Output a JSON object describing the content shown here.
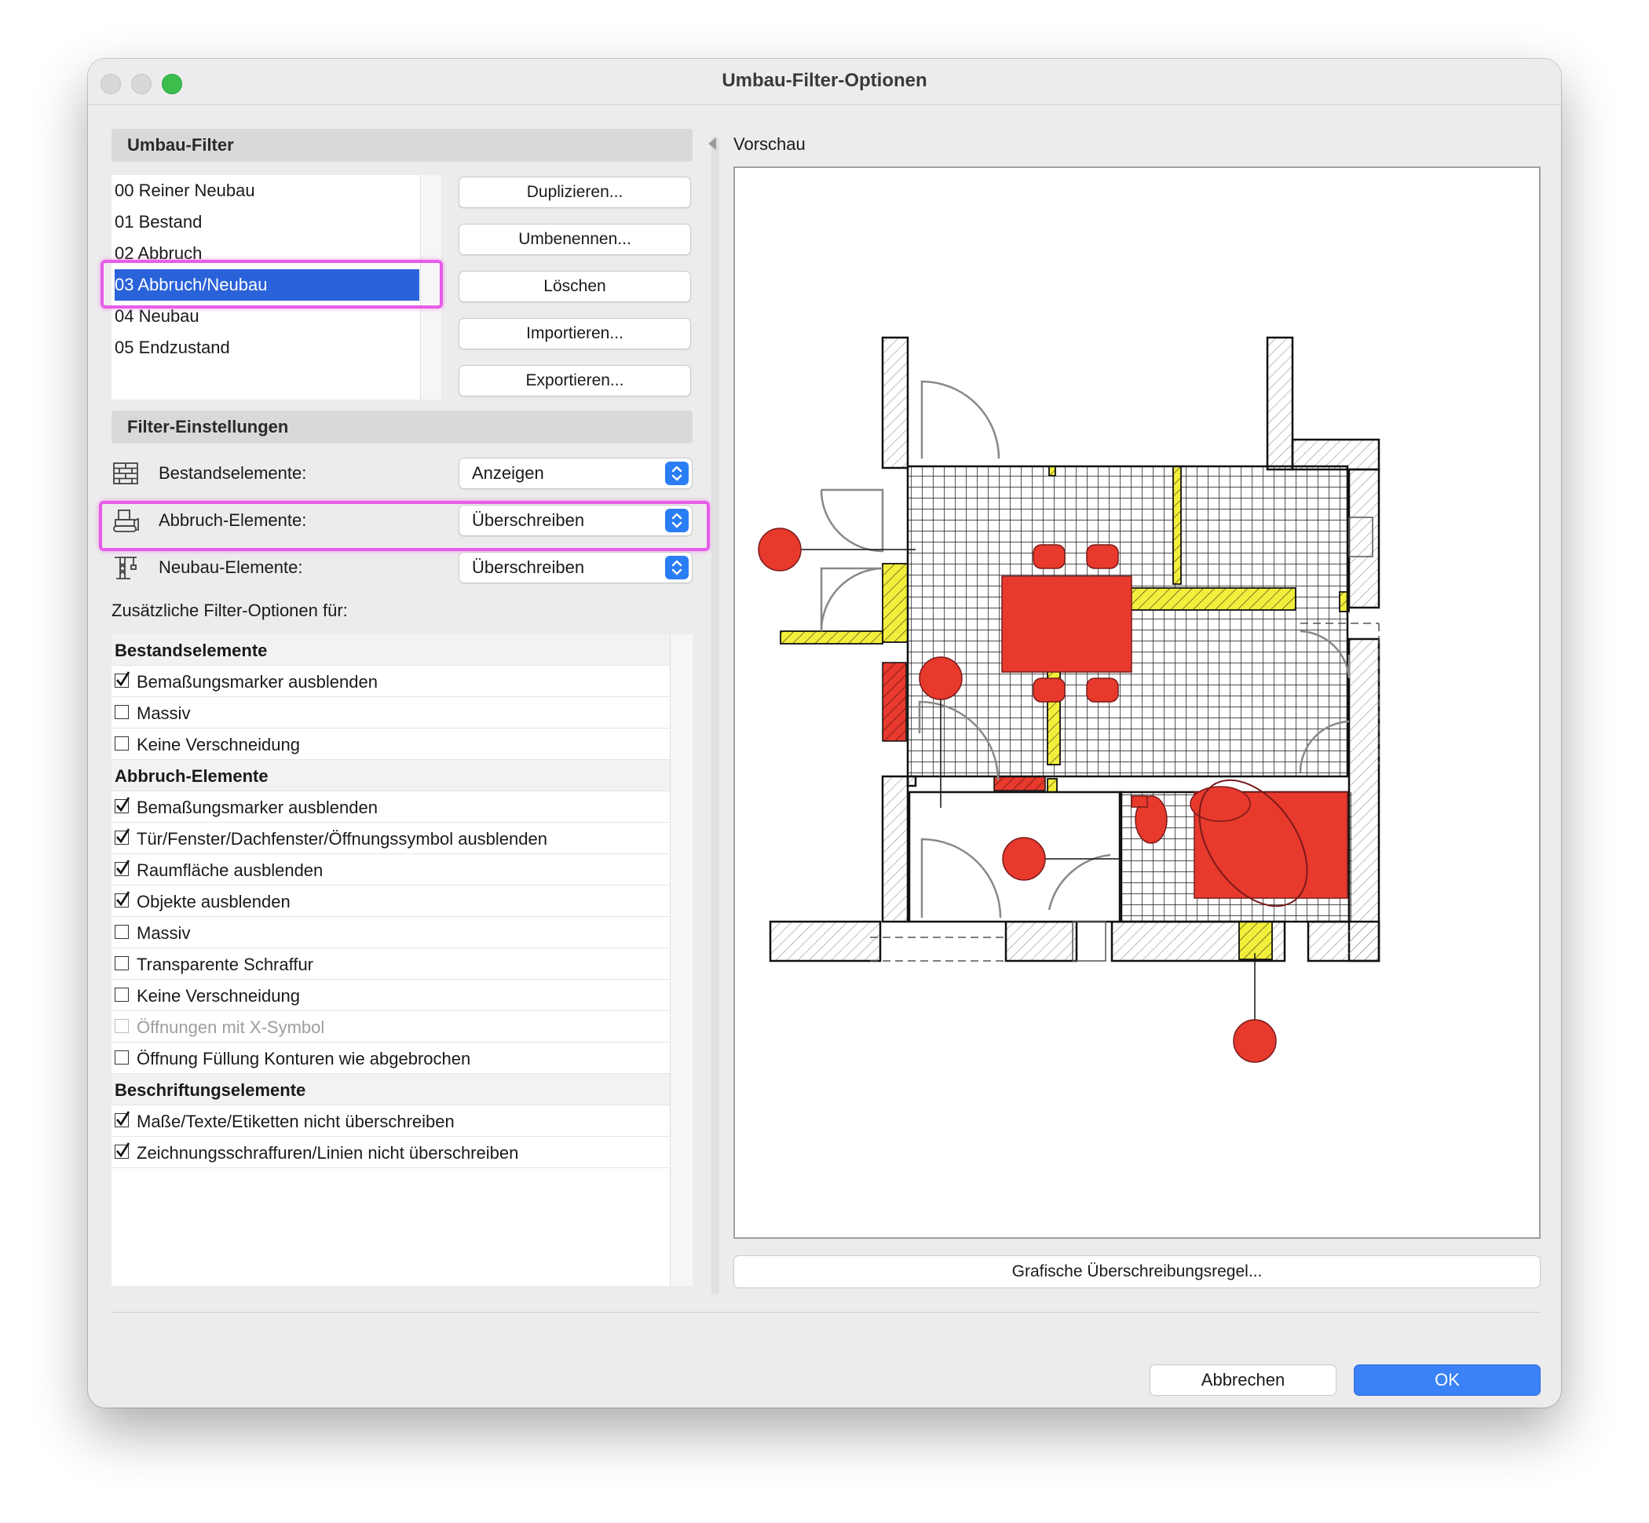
{
  "window": {
    "title": "Umbau-Filter-Optionen"
  },
  "filters": {
    "header": "Umbau-Filter",
    "items": [
      "00 Reiner Neubau",
      "01 Bestand",
      "02 Abbruch",
      "03 Abbruch/Neubau",
      "04 Neubau",
      "05 Endzustand"
    ],
    "selected": "03 Abbruch/Neubau"
  },
  "buttons": {
    "duplicate": "Duplizieren...",
    "rename": "Umbenennen...",
    "delete": "Löschen",
    "import": "Importieren...",
    "export": "Exportieren..."
  },
  "settings": {
    "header": "Filter-Einstellungen",
    "existing": {
      "label": "Bestandselemente:",
      "value": "Anzeigen"
    },
    "demolition": {
      "label": "Abbruch-Elemente:",
      "value": "Überschreiben"
    },
    "new": {
      "label": "Neubau-Elemente:",
      "value": "Überschreiben"
    },
    "extra_label": "Zusätzliche Filter-Optionen für:"
  },
  "options": {
    "groups": [
      {
        "title": "Bestandselemente",
        "items": [
          {
            "label": "Bemaßungsmarker ausblenden",
            "checked": true
          },
          {
            "label": "Massiv",
            "checked": false
          },
          {
            "label": "Keine Verschneidung",
            "checked": false
          }
        ]
      },
      {
        "title": "Abbruch-Elemente",
        "items": [
          {
            "label": "Bemaßungsmarker ausblenden",
            "checked": true
          },
          {
            "label": "Tür/Fenster/Dachfenster/Öffnungssymbol ausblenden",
            "checked": true
          },
          {
            "label": "Raumfläche ausblenden",
            "checked": true
          },
          {
            "label": "Objekte ausblenden",
            "checked": true
          },
          {
            "label": "Massiv",
            "checked": false
          },
          {
            "label": "Transparente Schraffur",
            "checked": false
          },
          {
            "label": "Keine Verschneidung",
            "checked": false
          },
          {
            "label": "Öffnungen mit X-Symbol",
            "checked": false,
            "disabled": true
          },
          {
            "label": "Öffnung Füllung Konturen wie abgebrochen",
            "checked": false
          }
        ]
      },
      {
        "title": "Beschriftungselemente",
        "items": [
          {
            "label": "Maße/Texte/Etiketten nicht überschreiben",
            "checked": true
          },
          {
            "label": "Zeichnungsschraffuren/Linien nicht überschreiben",
            "checked": true
          }
        ]
      }
    ]
  },
  "preview": {
    "label": "Vorschau",
    "override_button": "Grafische Überschreibungsregel..."
  },
  "footer": {
    "cancel": "Abbrechen",
    "ok": "OK"
  },
  "colors": {
    "selection": "#2a62d9",
    "accent": "#3b82f6",
    "highlight": "#e85ce8",
    "demolition_fill": "#e8392d",
    "new_fill": "#f2ef3c"
  },
  "icons": {
    "existing": "brick-wall-icon",
    "demolition": "bulldozer-icon",
    "new": "crane-icon",
    "select": "updown-chevron-icon"
  }
}
